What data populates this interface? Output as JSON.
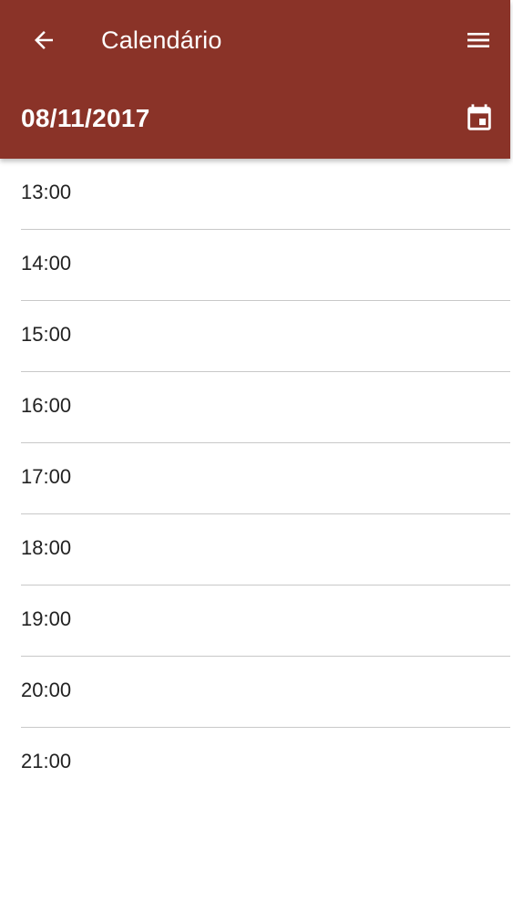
{
  "header": {
    "title": "Calendário",
    "back_icon": "arrow-back-icon",
    "menu_icon": "menu-icon",
    "background_color": "#8a3328"
  },
  "date_bar": {
    "date": "08/11/2017",
    "calendar_icon": "calendar-event-icon"
  },
  "hours": [
    {
      "label": "13:00"
    },
    {
      "label": "14:00"
    },
    {
      "label": "15:00"
    },
    {
      "label": "16:00"
    },
    {
      "label": "17:00"
    },
    {
      "label": "18:00"
    },
    {
      "label": "19:00"
    },
    {
      "label": "20:00"
    },
    {
      "label": "21:00"
    }
  ]
}
